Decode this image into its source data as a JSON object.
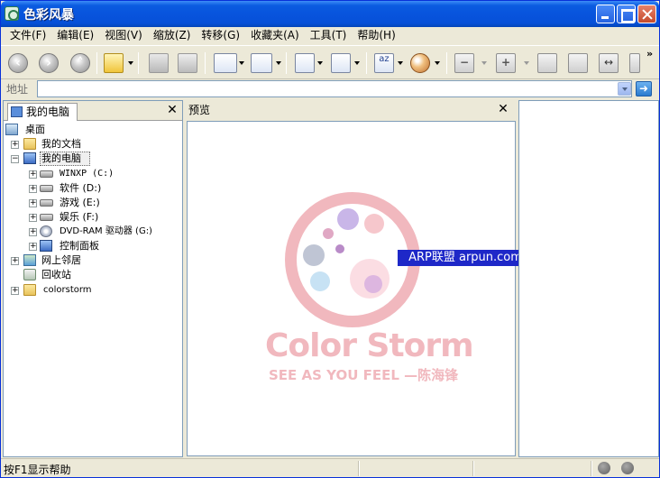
{
  "window": {
    "title": "色彩风暴"
  },
  "menu": [
    "文件(F)",
    "编辑(E)",
    "视图(V)",
    "缩放(Z)",
    "转移(G)",
    "收藏夹(A)",
    "工具(T)",
    "帮助(H)"
  ],
  "address": {
    "label": "地址",
    "value": ""
  },
  "left_pane": {
    "tab_label": "我的电脑",
    "tree": [
      {
        "label": "桌面"
      },
      {
        "label": "我的文档"
      },
      {
        "label": "我的电脑"
      },
      {
        "label": "WINXP  (C:)"
      },
      {
        "label": "软件  (D:)"
      },
      {
        "label": "游戏  (E:)"
      },
      {
        "label": "娱乐  (F:)"
      },
      {
        "label": "DVD-RAM 驱动器  (G:)"
      },
      {
        "label": "控制面板"
      },
      {
        "label": "网上邻居"
      },
      {
        "label": "回收站"
      },
      {
        "label": "colorstorm"
      }
    ]
  },
  "preview": {
    "title": "预览",
    "logo_name": "Color Storm",
    "logo_slogan": "SEE AS YOU FEEL  —陈海锋",
    "watermark": "ARP联盟  arpun.com"
  },
  "status": {
    "text": "按F1显示帮助"
  },
  "colors": {
    "titlebar": "#0854DD",
    "logo_pink": "#F1B8BE",
    "watermark_bg": "#1E28C8"
  }
}
